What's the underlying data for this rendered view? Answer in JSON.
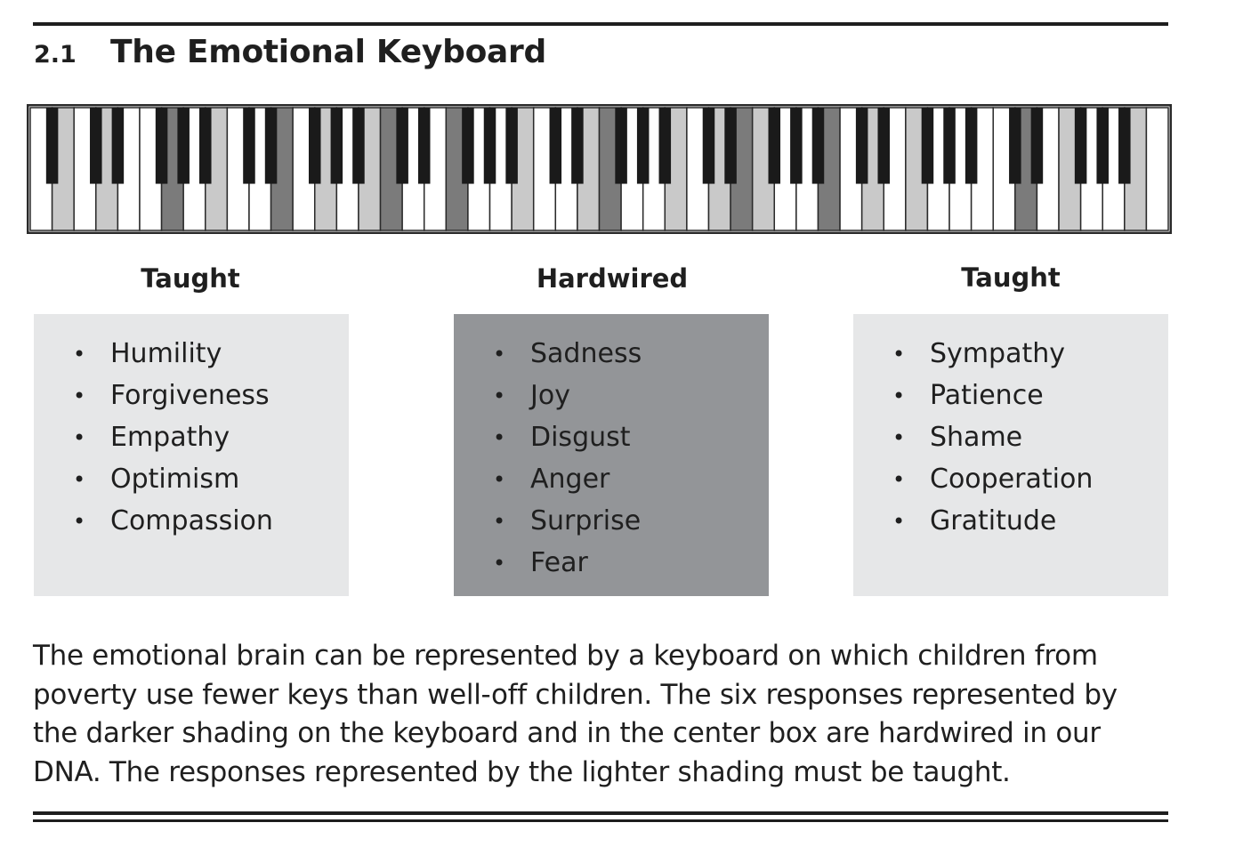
{
  "figure": {
    "number": "2.1",
    "title": "The Emotional Keyboard"
  },
  "keyboard": {
    "white_key_count": 52,
    "colors": {
      "outline": "#2a2a2a",
      "white_key": "#ffffff",
      "black_key": "#1a1a1a",
      "light_shade": "#c9c9c9",
      "dark_shade": "#7b7b7b"
    }
  },
  "columns": [
    {
      "heading": "Taught",
      "shade": "light",
      "items": [
        "Humility",
        "Forgiveness",
        "Empathy",
        "Optimism",
        "Compassion"
      ]
    },
    {
      "heading": "Hardwired",
      "shade": "dark",
      "items": [
        "Sadness",
        "Joy",
        "Disgust",
        "Anger",
        "Surprise",
        "Fear"
      ]
    },
    {
      "heading": "Taught",
      "shade": "light",
      "items": [
        "Sympathy",
        "Patience",
        "Shame",
        "Cooperation",
        "Gratitude"
      ]
    }
  ],
  "bullet": "•",
  "caption": {
    "lines": [
      "The emotional brain can be represented by a keyboard on which children from",
      "poverty use fewer keys than well-off children. The six responses represented by",
      "the darker shading on the keyboard and in the center box are hardwired in our",
      "DNA. The responses represented by the lighter shading must be taught."
    ]
  },
  "colors": {
    "box_light": "#e6e7e8",
    "box_dark": "#939598",
    "rule": "#1e1e1e"
  }
}
